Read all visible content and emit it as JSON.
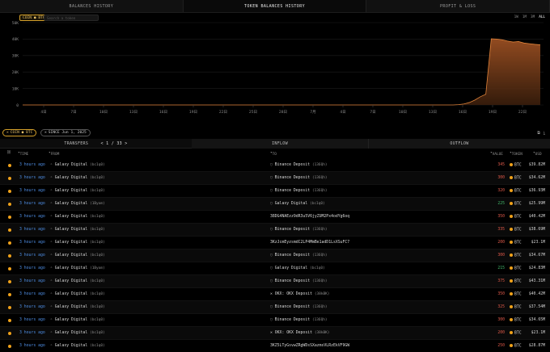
{
  "tabs": [
    "BALANCES HISTORY",
    "TOKEN BALANCES HISTORY",
    "PROFIT & LOSS"
  ],
  "chart_header": {
    "coin_chip": "COIN ● BTC",
    "search_placeholder": "Search a token",
    "ranges": [
      "1W",
      "1M",
      "3M",
      "ALL"
    ],
    "active_range": "ALL"
  },
  "chart_data": {
    "type": "area",
    "y_ticks": [
      "50K",
      "40K",
      "30K",
      "20K",
      "10K",
      "0"
    ],
    "ylim": [
      0,
      50000
    ],
    "x_ticks": [
      "4日",
      "7日",
      "10日",
      "13日",
      "16日",
      "19日",
      "22日",
      "25日",
      "28日",
      "7月",
      "4日",
      "7日",
      "10日",
      "13日",
      "16日",
      "19日",
      "22日"
    ],
    "series": [
      {
        "values": [
          0,
          0,
          0,
          0,
          0,
          0,
          0,
          0,
          0,
          0,
          0,
          0,
          0,
          0,
          0,
          0,
          0,
          0,
          0,
          0,
          0,
          0,
          0,
          0,
          0,
          0,
          0,
          0,
          0,
          0,
          0,
          0,
          0,
          0,
          0,
          0,
          0,
          0,
          0,
          0,
          0,
          0,
          0,
          0,
          0,
          0,
          0,
          0,
          0,
          0,
          0,
          0,
          0,
          0,
          0,
          0,
          0,
          0,
          0,
          0,
          0,
          0,
          0,
          0,
          0,
          0,
          0,
          0,
          0,
          0,
          0,
          0,
          0,
          0,
          0,
          0,
          0,
          0,
          0,
          0,
          200,
          600,
          1500,
          3000,
          5000,
          6500,
          40200,
          40000,
          39600,
          38800,
          38200,
          38500,
          37600,
          37200,
          36800,
          36500
        ]
      }
    ],
    "color": "#e0833a"
  },
  "filters": {
    "coin": "COIN ● BTC",
    "since": "SINCE Jun 1, 2025"
  },
  "section": {
    "transfers": "TRANSFERS",
    "page": "< 1 / 33 >",
    "inflow": "INFLOW",
    "outflow": "OUTFLOW"
  },
  "columns": {
    "time": "TIME",
    "from": "FROM",
    "to": "TO",
    "value": "VALUE",
    "token": "TOKEN",
    "usd": "USD"
  },
  "transfers": [
    {
      "time": "3 hours ago",
      "from": "Galaxy Digital",
      "from_tag": "(bc1q0)",
      "to": "Binance Deposit",
      "to_tag": "(136Qh)",
      "value": "345",
      "dir": "out",
      "token": "BTC",
      "usd": "$39.82M"
    },
    {
      "time": "3 hours ago",
      "from": "Galaxy Digital",
      "from_tag": "(bc1q0)",
      "to": "Binance Deposit",
      "to_tag": "(136Qh)",
      "value": "300",
      "dir": "out",
      "token": "BTC",
      "usd": "$34.62M"
    },
    {
      "time": "3 hours ago",
      "from": "Galaxy Digital",
      "from_tag": "(bc1q0)",
      "to": "Binance Deposit",
      "to_tag": "(136Qh)",
      "value": "320",
      "dir": "out",
      "token": "BTC",
      "usd": "$36.93M"
    },
    {
      "time": "3 hours ago",
      "from": "Galaxy Digital",
      "from_tag": "(1Byom)",
      "to": "Galaxy Digital",
      "to_tag": "(bc1q0)",
      "value": "225",
      "dir": "in",
      "token": "BTC",
      "usd": "$25.99M"
    },
    {
      "time": "3 hours ago",
      "from": "Galaxy Digital",
      "from_tag": "(bc1q0)",
      "to": "38DG4NAEzz9dR3u5V6jyZUM2Px4odYg6oq",
      "to_tag": "",
      "value": "350",
      "dir": "out",
      "token": "BTC",
      "usd": "$40.42M"
    },
    {
      "time": "3 hours ago",
      "from": "Galaxy Digital",
      "from_tag": "(bc1q0)",
      "to": "Binance Deposit",
      "to_tag": "(136Qh)",
      "value": "335",
      "dir": "out",
      "token": "BTC",
      "usd": "$38.69M"
    },
    {
      "time": "3 hours ago",
      "from": "Galaxy Digital",
      "from_tag": "(bc1q0)",
      "to": "3KzJcmEyzsmdC2LP4MmBe1adD1LsXSuFC7",
      "to_tag": "",
      "value": "200",
      "dir": "out",
      "token": "BTC",
      "usd": "$23.1M"
    },
    {
      "time": "3 hours ago",
      "from": "Galaxy Digital",
      "from_tag": "(bc1q0)",
      "to": "Binance Deposit",
      "to_tag": "(136Qh)",
      "value": "300",
      "dir": "out",
      "token": "BTC",
      "usd": "$34.67M"
    },
    {
      "time": "3 hours ago",
      "from": "Galaxy Digital",
      "from_tag": "(1Byom)",
      "to": "Galaxy Digital",
      "to_tag": "(bc1q0)",
      "value": "215",
      "dir": "in",
      "token": "BTC",
      "usd": "$24.83M"
    },
    {
      "time": "3 hours ago",
      "from": "Galaxy Digital",
      "from_tag": "(bc1q0)",
      "to": "Binance Deposit",
      "to_tag": "(136Qh)",
      "value": "375",
      "dir": "out",
      "token": "BTC",
      "usd": "$43.31M"
    },
    {
      "time": "3 hours ago",
      "from": "Galaxy Digital",
      "from_tag": "(bc1q0)",
      "to": "OKX: OKX Deposit",
      "to_tag": "(38kBK)",
      "value": "350",
      "dir": "out",
      "token": "BTC",
      "usd": "$40.42M"
    },
    {
      "time": "3 hours ago",
      "from": "Galaxy Digital",
      "from_tag": "(bc1q0)",
      "to": "Binance Deposit",
      "to_tag": "(136Qh)",
      "value": "325",
      "dir": "out",
      "token": "BTC",
      "usd": "$37.54M"
    },
    {
      "time": "3 hours ago",
      "from": "Galaxy Digital",
      "from_tag": "(bc1q0)",
      "to": "Binance Deposit",
      "to_tag": "(136Qh)",
      "value": "300",
      "dir": "out",
      "token": "BTC",
      "usd": "$34.65M"
    },
    {
      "time": "3 hours ago",
      "from": "Galaxy Digital",
      "from_tag": "(bc1q0)",
      "to": "OKX: OKX Deposit",
      "to_tag": "(38kBK)",
      "value": "200",
      "dir": "out",
      "token": "BTC",
      "usd": "$23.1M"
    },
    {
      "time": "3 hours ago",
      "from": "Galaxy Digital",
      "from_tag": "(bc1q0)",
      "to": "3KZ5LTyGsvwZRgWDsSXazmsVLRzEkVF9GW",
      "to_tag": "",
      "value": "250",
      "dir": "out",
      "token": "BTC",
      "usd": "$28.87M"
    }
  ]
}
